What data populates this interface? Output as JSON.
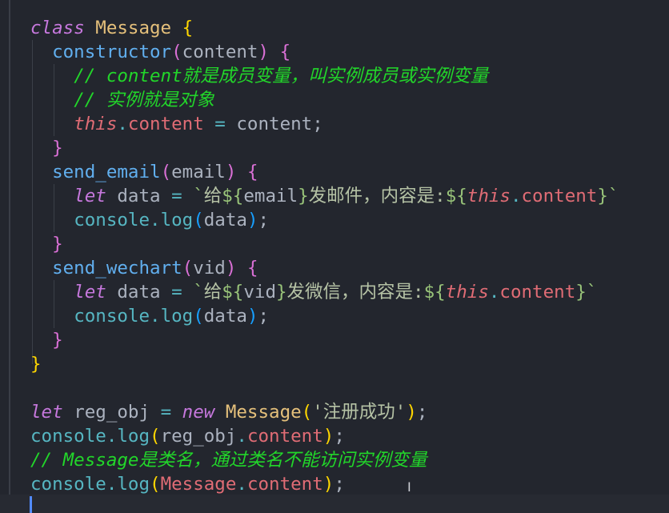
{
  "colors": {
    "kw": "#c678dd",
    "cls": "#e5c07b",
    "br1": "#ffd700",
    "br2": "#da70d6",
    "br3": "#179fff",
    "fn": "#61afef",
    "plain": "#abb2bf",
    "cm": "#22d62a",
    "th": "#e06c75",
    "prop": "#e06c75",
    "op": "#56b6c2",
    "cons": "#56b6c2",
    "str": "#98c379",
    "strcn": "#b5c2a5"
  },
  "lines": [
    [
      {
        "t": "class ",
        "c": "kw",
        "i": 1
      },
      {
        "t": "Message ",
        "c": "cls"
      },
      {
        "t": "{",
        "c": "br1"
      }
    ],
    [
      {
        "t": "  "
      },
      {
        "t": "constructor",
        "c": "fn"
      },
      {
        "t": "(",
        "c": "br2"
      },
      {
        "t": "content",
        "c": "plain"
      },
      {
        "t": ")",
        "c": "br2"
      },
      {
        "t": " "
      },
      {
        "t": "{",
        "c": "br2"
      }
    ],
    [
      {
        "t": "    "
      },
      {
        "t": "// content就是成员变量，叫实例成员或实例变量",
        "c": "cm",
        "i": 1
      }
    ],
    [
      {
        "t": "    "
      },
      {
        "t": "// 实例就是对象",
        "c": "cm",
        "i": 1
      }
    ],
    [
      {
        "t": "    "
      },
      {
        "t": "this",
        "c": "th",
        "i": 1
      },
      {
        "t": ".",
        "c": "op"
      },
      {
        "t": "content",
        "c": "prop"
      },
      {
        "t": " = ",
        "c": "op"
      },
      {
        "t": "content;",
        "c": "plain"
      }
    ],
    [
      {
        "t": "  "
      },
      {
        "t": "}",
        "c": "br2"
      }
    ],
    [
      {
        "t": "  "
      },
      {
        "t": "send_email",
        "c": "fn"
      },
      {
        "t": "(",
        "c": "br2"
      },
      {
        "t": "email",
        "c": "plain"
      },
      {
        "t": ")",
        "c": "br2"
      },
      {
        "t": " "
      },
      {
        "t": "{",
        "c": "br2"
      }
    ],
    [
      {
        "t": "    "
      },
      {
        "t": "let ",
        "c": "kw",
        "i": 1
      },
      {
        "t": "data ",
        "c": "plain"
      },
      {
        "t": "= ",
        "c": "op"
      },
      {
        "t": "`",
        "c": "str"
      },
      {
        "t": "给",
        "c": "strcn"
      },
      {
        "t": "${",
        "c": "str"
      },
      {
        "t": "email",
        "c": "plain"
      },
      {
        "t": "}",
        "c": "str"
      },
      {
        "t": "发邮件，内容是:",
        "c": "strcn"
      },
      {
        "t": "${",
        "c": "str"
      },
      {
        "t": "this",
        "c": "th",
        "i": 1
      },
      {
        "t": ".",
        "c": "op"
      },
      {
        "t": "content",
        "c": "prop"
      },
      {
        "t": "}`",
        "c": "str"
      }
    ],
    [
      {
        "t": "    "
      },
      {
        "t": "console",
        "c": "cons"
      },
      {
        "t": ".",
        "c": "op"
      },
      {
        "t": "log",
        "c": "cons"
      },
      {
        "t": "(",
        "c": "br3"
      },
      {
        "t": "data",
        "c": "plain"
      },
      {
        "t": ")",
        "c": "br3"
      },
      {
        "t": ";",
        "c": "plain"
      }
    ],
    [
      {
        "t": "  "
      },
      {
        "t": "}",
        "c": "br2"
      }
    ],
    [
      {
        "t": "  "
      },
      {
        "t": "send_wechart",
        "c": "fn"
      },
      {
        "t": "(",
        "c": "br2"
      },
      {
        "t": "vid",
        "c": "plain"
      },
      {
        "t": ")",
        "c": "br2"
      },
      {
        "t": " "
      },
      {
        "t": "{",
        "c": "br2"
      }
    ],
    [
      {
        "t": "    "
      },
      {
        "t": "let ",
        "c": "kw",
        "i": 1
      },
      {
        "t": "data ",
        "c": "plain"
      },
      {
        "t": "= ",
        "c": "op"
      },
      {
        "t": "`",
        "c": "str"
      },
      {
        "t": "给",
        "c": "strcn"
      },
      {
        "t": "${",
        "c": "str"
      },
      {
        "t": "vid",
        "c": "plain"
      },
      {
        "t": "}",
        "c": "str"
      },
      {
        "t": "发微信，内容是:",
        "c": "strcn"
      },
      {
        "t": "${",
        "c": "str"
      },
      {
        "t": "this",
        "c": "th",
        "i": 1
      },
      {
        "t": ".",
        "c": "op"
      },
      {
        "t": "content",
        "c": "prop"
      },
      {
        "t": "}`",
        "c": "str"
      }
    ],
    [
      {
        "t": "    "
      },
      {
        "t": "console",
        "c": "cons"
      },
      {
        "t": ".",
        "c": "op"
      },
      {
        "t": "log",
        "c": "cons"
      },
      {
        "t": "(",
        "c": "br3"
      },
      {
        "t": "data",
        "c": "plain"
      },
      {
        "t": ")",
        "c": "br3"
      },
      {
        "t": ";",
        "c": "plain"
      }
    ],
    [
      {
        "t": "  "
      },
      {
        "t": "}",
        "c": "br2"
      }
    ],
    [
      {
        "t": "}",
        "c": "br1"
      }
    ],
    [],
    [
      {
        "t": "let ",
        "c": "kw",
        "i": 1
      },
      {
        "t": "reg_obj ",
        "c": "plain"
      },
      {
        "t": "= ",
        "c": "op"
      },
      {
        "t": "new ",
        "c": "kw",
        "i": 1
      },
      {
        "t": "Message",
        "c": "cls"
      },
      {
        "t": "(",
        "c": "br1"
      },
      {
        "t": "'注册成功'",
        "c": "strcn"
      },
      {
        "t": ")",
        "c": "br1"
      },
      {
        "t": ";",
        "c": "plain"
      }
    ],
    [
      {
        "t": "console",
        "c": "cons"
      },
      {
        "t": ".",
        "c": "op"
      },
      {
        "t": "log",
        "c": "cons"
      },
      {
        "t": "(",
        "c": "br1"
      },
      {
        "t": "reg_obj",
        "c": "plain"
      },
      {
        "t": ".",
        "c": "op"
      },
      {
        "t": "content",
        "c": "prop"
      },
      {
        "t": ")",
        "c": "br1"
      },
      {
        "t": ";",
        "c": "plain"
      }
    ],
    [
      {
        "t": "// Message是类名，通过类名不能访问实例变量",
        "c": "cm",
        "i": 1
      }
    ],
    [
      {
        "t": "console",
        "c": "cons"
      },
      {
        "t": ".",
        "c": "op"
      },
      {
        "t": "log",
        "c": "cons"
      },
      {
        "t": "(",
        "c": "br1"
      },
      {
        "t": "Message",
        "c": "th"
      },
      {
        "t": ".",
        "c": "op"
      },
      {
        "t": "content",
        "c": "prop"
      },
      {
        "t": ")",
        "c": "br1"
      },
      {
        "t": ";",
        "c": "plain"
      }
    ]
  ]
}
